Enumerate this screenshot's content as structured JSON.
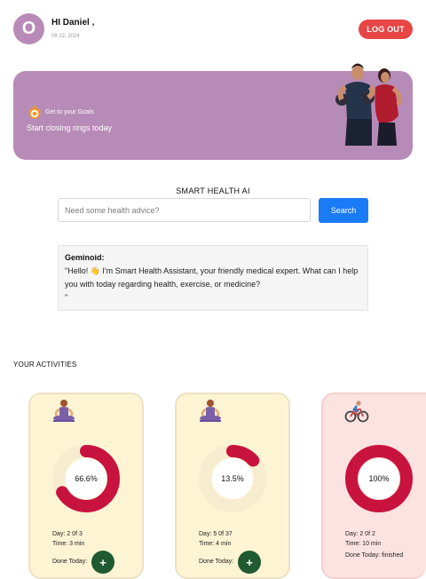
{
  "header": {
    "avatar_initial": "O",
    "greeting": "HI Daniel ,",
    "date": "08 22, 2024",
    "logout_label": "LOG OUT"
  },
  "banner": {
    "goal_label": "Get to your Goals",
    "subtitle": "Start closing rings today",
    "background_color": "#b78bb7"
  },
  "ai": {
    "title": "SMART HEALTH AI",
    "search_placeholder": "Need some health advice?",
    "search_value": "",
    "search_button": "Search",
    "response_title": "Geminoid:",
    "response_text": "\"Hello! 👋 I'm Smart Health Assistant, your friendly medical expert. What can I help you with today regarding health, exercise, or medicine?",
    "response_tail": "\""
  },
  "activities": {
    "title": "YOUR ACTIVITIES",
    "cards": [
      {
        "icon": "meditation-icon",
        "progress_label": "66.6%",
        "progress": 0.666,
        "day": "Day:  2 0f 3",
        "time": "Time:  3 min",
        "done": "Done Today:",
        "ring_color": "#c8133e",
        "bg_color": "#fdf4d4"
      },
      {
        "icon": "meditation-icon",
        "progress_label": "13.5%",
        "progress": 0.135,
        "day": "Day:  5 0f 37",
        "time": "Time:  4 min",
        "done": "Done Today:",
        "ring_color": "#c8133e",
        "bg_color": "#fdf4d4"
      },
      {
        "icon": "cycling-icon",
        "progress_label": "100%",
        "progress": 1.0,
        "day": "Day:  2 0f 2",
        "time": "Time:  10 min",
        "done": "Done Today: finished",
        "ring_color": "#c8133e",
        "bg_color": "#fde2e2"
      }
    ],
    "add_label": "+"
  }
}
